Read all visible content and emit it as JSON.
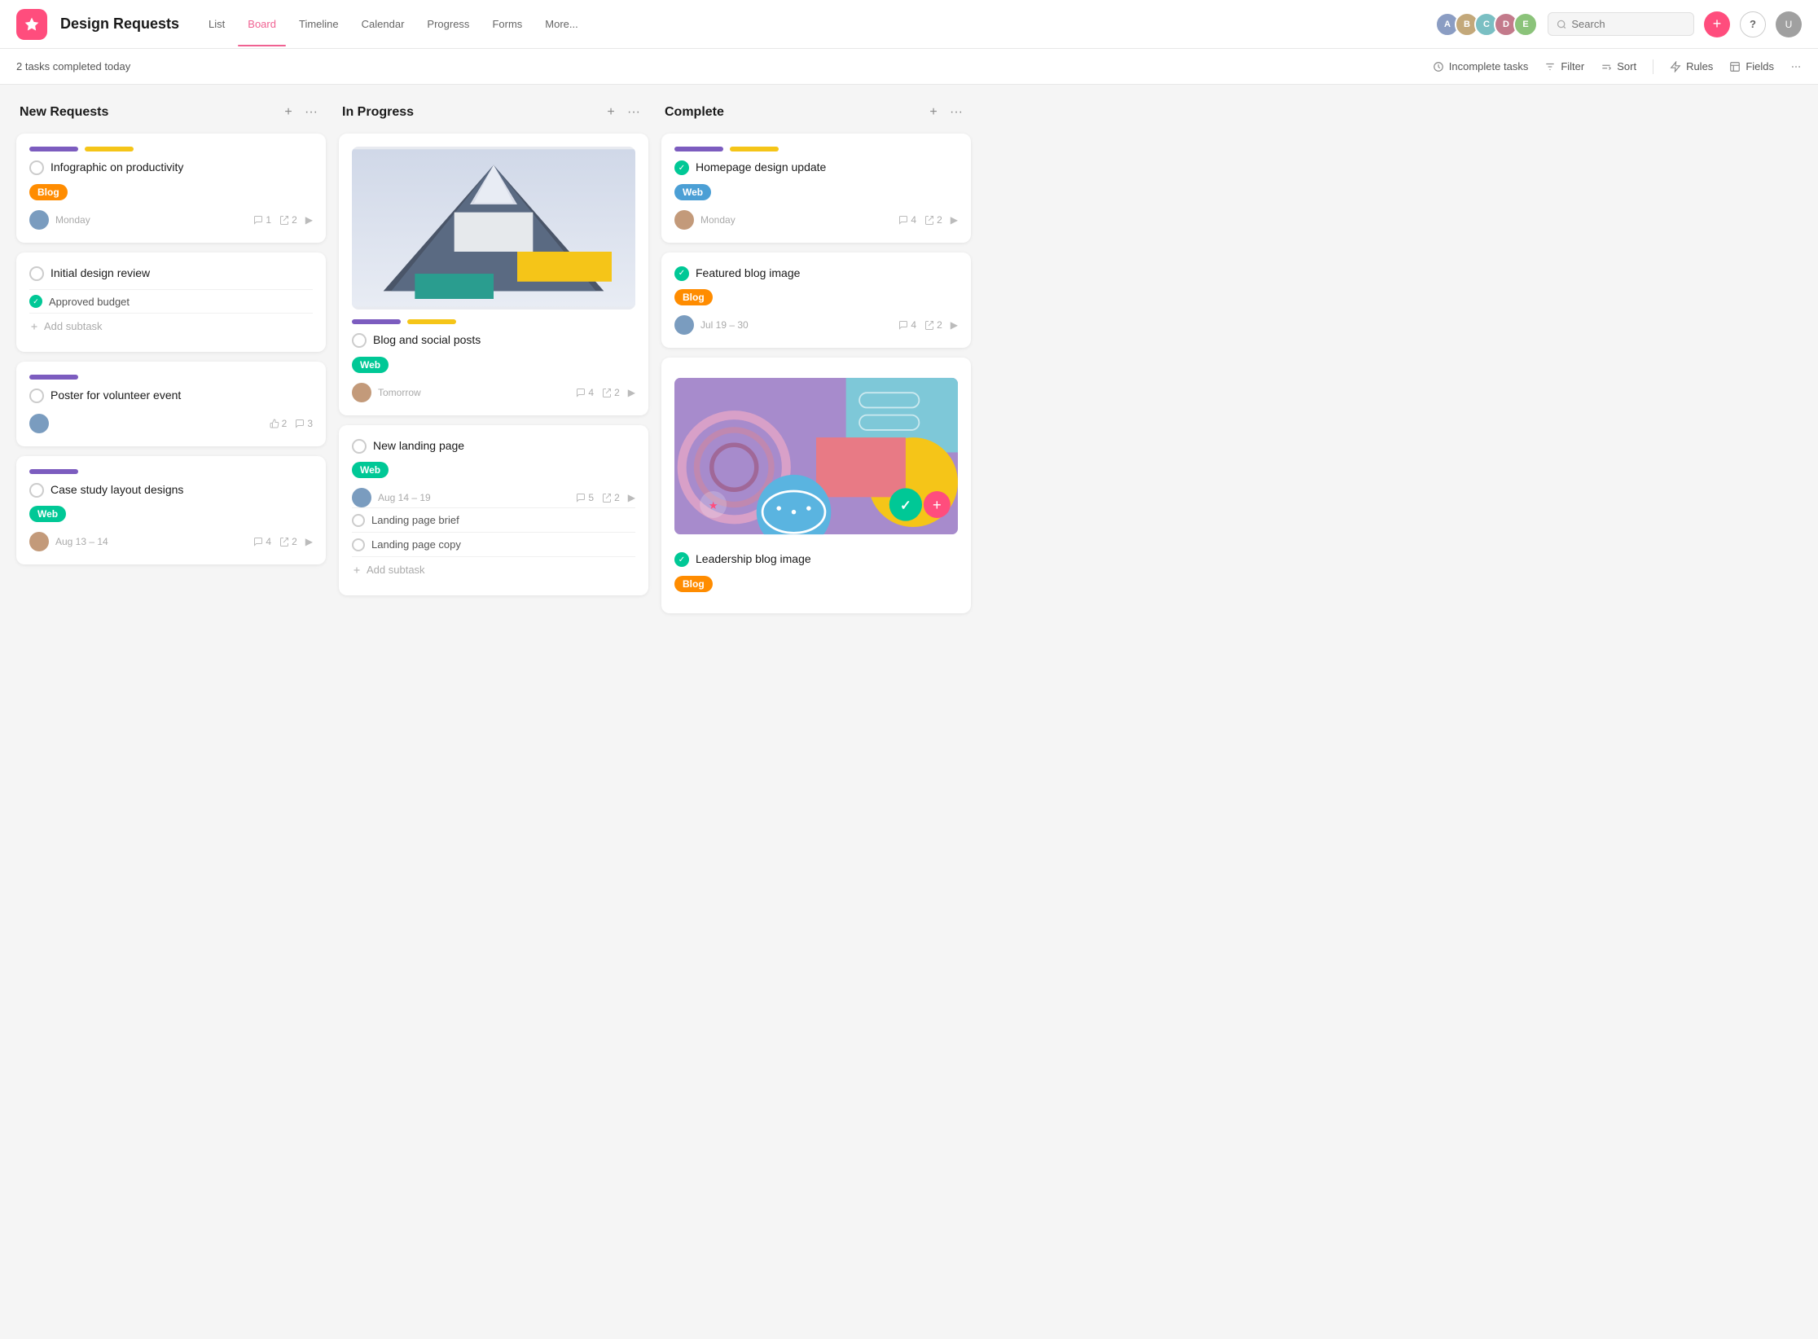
{
  "app": {
    "title": "Design Requests",
    "icon": "star"
  },
  "nav": {
    "tabs": [
      {
        "id": "list",
        "label": "List",
        "active": false
      },
      {
        "id": "board",
        "label": "Board",
        "active": true
      },
      {
        "id": "timeline",
        "label": "Timeline",
        "active": false
      },
      {
        "id": "calendar",
        "label": "Calendar",
        "active": false
      },
      {
        "id": "progress",
        "label": "Progress",
        "active": false
      },
      {
        "id": "forms",
        "label": "Forms",
        "active": false
      },
      {
        "id": "more",
        "label": "More...",
        "active": false
      }
    ],
    "search_placeholder": "Search"
  },
  "statusBar": {
    "tasks_completed": "2 tasks completed today",
    "incomplete_tasks": "Incomplete tasks",
    "filter": "Filter",
    "sort": "Sort",
    "rules": "Rules",
    "fields": "Fields"
  },
  "columns": [
    {
      "id": "new-requests",
      "title": "New Requests",
      "cards": [
        {
          "id": "card-1",
          "title": "Infographic on productivity",
          "badge": "Blog",
          "badge_type": "orange",
          "tags": [
            "purple",
            "yellow"
          ],
          "date": "Monday",
          "comments": "1",
          "subtasks_count": "2",
          "has_arrow": true,
          "avatar_color": "#7a9cbf"
        },
        {
          "id": "card-2",
          "title": "Initial design review",
          "tags": [],
          "subtask": "Approved budget",
          "add_subtask": "Add subtask"
        },
        {
          "id": "card-3",
          "title": "Poster for volunteer event",
          "tags": [
            "purple"
          ],
          "date": "",
          "likes": "2",
          "comments": "3",
          "avatar_color": "#7a9cbf"
        },
        {
          "id": "card-4",
          "title": "Case study layout designs",
          "badge": "Web",
          "badge_type": "teal",
          "tags": [
            "purple"
          ],
          "date": "Aug 13 – 14",
          "comments": "4",
          "subtasks_count": "2",
          "has_arrow": true,
          "avatar_color": "#c39a7a"
        }
      ]
    },
    {
      "id": "in-progress",
      "title": "In Progress",
      "cards": [
        {
          "id": "card-5",
          "title": "Blog and social posts",
          "badge": "Web",
          "badge_type": "teal",
          "tags": [
            "purple",
            "yellow"
          ],
          "date": "Tomorrow",
          "comments": "4",
          "subtasks_count": "2",
          "has_arrow": true,
          "avatar_color": "#c39a7a",
          "has_image": true
        },
        {
          "id": "card-6",
          "title": "New landing page",
          "badge": "Web",
          "badge_type": "teal",
          "tags": [],
          "date": "Aug 14 – 19",
          "comments": "5",
          "subtasks_count": "2",
          "has_arrow": true,
          "avatar_color": "#7a9cbf",
          "subtask1": "Landing page brief",
          "subtask2": "Landing page copy",
          "add_subtask": "Add subtask"
        }
      ]
    },
    {
      "id": "complete",
      "title": "Complete",
      "cards": [
        {
          "id": "card-7",
          "title": "Homepage design update",
          "badge": "Web",
          "badge_type": "blue",
          "tags": [
            "purple",
            "yellow"
          ],
          "date": "Monday",
          "comments": "4",
          "subtasks_count": "2",
          "has_arrow": true,
          "avatar_color": "#c39a7a",
          "completed": true
        },
        {
          "id": "card-8",
          "title": "Featured blog image",
          "badge": "Blog",
          "badge_type": "orange",
          "tags": [],
          "date": "Jul 19 – 30",
          "comments": "4",
          "subtasks_count": "2",
          "has_arrow": true,
          "avatar_color": "#7a9cbf",
          "completed": true
        },
        {
          "id": "card-9",
          "title": "Leadership blog image",
          "badge": "Blog",
          "badge_type": "orange",
          "tags": [],
          "completed": true,
          "has_abstract_image": true
        }
      ]
    }
  ]
}
